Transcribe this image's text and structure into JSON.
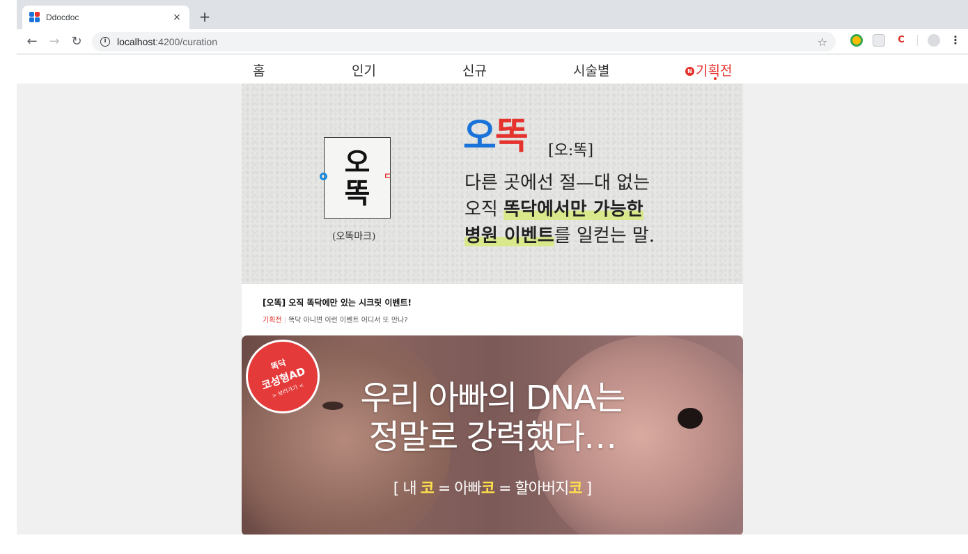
{
  "browser": {
    "tab": {
      "title": "Ddocdoc",
      "close": "×"
    },
    "new_tab": "+",
    "nav": {
      "back": "←",
      "forward": "→",
      "reload": "↻"
    },
    "url": {
      "host": "localhost",
      "path": ":4200/curation"
    },
    "star": "☆",
    "menu": "⋮"
  },
  "site_nav": {
    "items": [
      {
        "label": "홈"
      },
      {
        "label": "인기"
      },
      {
        "label": "신규"
      },
      {
        "label": "시술별"
      },
      {
        "label": "기획전",
        "active": true,
        "badge": "N"
      }
    ]
  },
  "banner1": {
    "mark": {
      "top": "오",
      "bottom": "똑",
      "side_dd": "ㄷ",
      "caption": "(오똑마크)"
    },
    "logo": {
      "blue": "오",
      "red": "똑",
      "pronunciation": "[오:똑]"
    },
    "slogan": {
      "line1": "다른 곳에선 절—대 없는",
      "line2_plain": "오직 ",
      "line2_bold": "똑닥에서만 가능한",
      "line3_bold": "병원 이벤트",
      "line3_plain": "를 일컫는 말."
    }
  },
  "card1": {
    "title": "[오똑] 오직 똑닥에만 있는 시크릿 이벤트!",
    "category": "기획전",
    "separator": "|",
    "subtitle": "똑닥 아니면 이런 이벤트 어디서 또 만나?"
  },
  "banner2": {
    "badge": {
      "brand": "똑닥",
      "label": "코성형AD",
      "more": "> 보러가기 <"
    },
    "headline1": "우리 아빠의 DNA는",
    "headline2": "정말로 강력했다…",
    "equation": {
      "open": "[ 내 ",
      "k1": "코",
      "eq1": " = 아빠",
      "k2": "코",
      "eq2": " = 할아버지",
      "k3": "코",
      "close": " ]"
    }
  },
  "colors": {
    "accent": "#e5322d",
    "brand_blue": "#1a73d9",
    "highlight": "#ffe14d"
  }
}
